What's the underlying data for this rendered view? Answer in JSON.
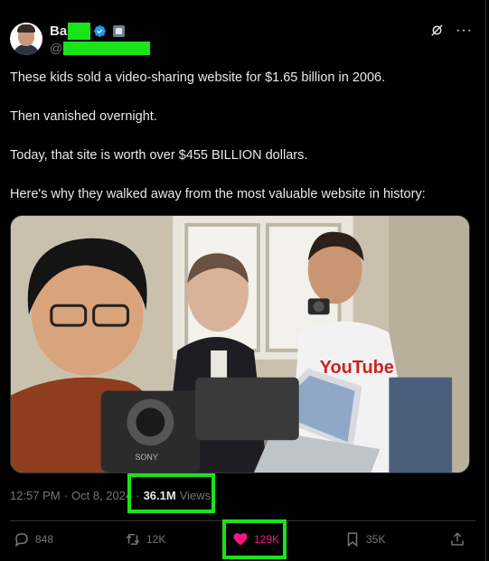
{
  "author": {
    "name_visible": "Ba",
    "handle_prefix": "@"
  },
  "tweet": {
    "paragraphs": [
      "These kids sold a video-sharing website for $1.65 billion in 2006.",
      "Then vanished overnight.",
      "Today, that site is worth over $455 BILLION dollars.",
      "Here's why they walked away from the most valuable website in history:"
    ],
    "media_brand_text": "YouTube",
    "camera_brand_text": "SONY"
  },
  "meta": {
    "time": "12:57 PM",
    "separator": "·",
    "date": "Oct 8, 2024",
    "views_count": "36.1M",
    "views_label": "Views"
  },
  "stats": {
    "replies": "848",
    "reposts": "12K",
    "likes": "129K",
    "bookmarks": "35K"
  },
  "colors": {
    "background": "#000000",
    "text": "#e7e9ea",
    "muted": "#71767b",
    "like": "#f91880",
    "verified": "#1d9bf0",
    "highlight": "#19e319"
  },
  "icons": [
    "verified-icon",
    "grok-icon",
    "more-icon",
    "reply-icon",
    "repost-icon",
    "heart-icon",
    "bookmark-icon",
    "share-icon"
  ]
}
